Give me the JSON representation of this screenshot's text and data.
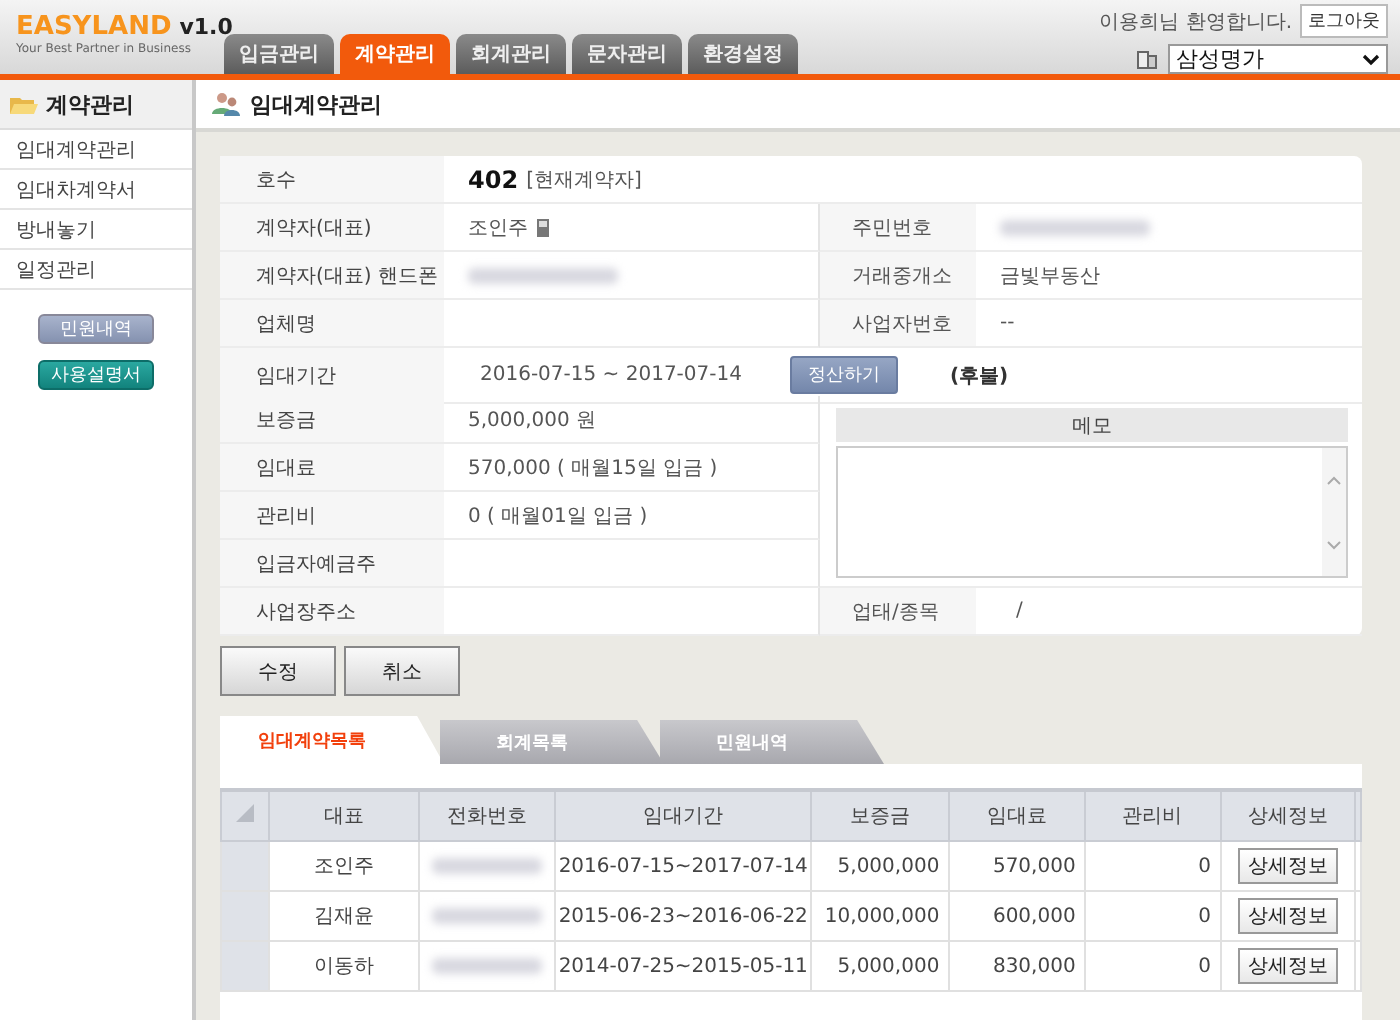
{
  "header": {
    "logo": "EASYLAND",
    "version": "v1.0",
    "tagline": "Your Best Partner in Business",
    "welcome": "이용희님 환영합니다.",
    "logout": "로그아웃",
    "building_select": "삼성명가",
    "tabs": [
      {
        "label": "입금관리",
        "selected": false
      },
      {
        "label": "계약관리",
        "selected": true
      },
      {
        "label": "회계관리",
        "selected": false
      },
      {
        "label": "문자관리",
        "selected": false
      },
      {
        "label": "환경설정",
        "selected": false
      }
    ]
  },
  "sidebar": {
    "title": "계약관리",
    "items": [
      "임대계약관리",
      "임대차계약서",
      "방내놓기",
      "일정관리"
    ],
    "buttons": [
      {
        "label": "민원내역",
        "kind": "grey"
      },
      {
        "label": "사용설명서",
        "kind": "teal"
      }
    ]
  },
  "page_title": "임대계약관리",
  "form": {
    "unit": {
      "label": "호수",
      "value": "402",
      "status": "[현재계약자]"
    },
    "pairs": [
      {
        "label": "계약자(대표)",
        "value": "조인주",
        "phone_icon": true,
        "label2": "주민번호",
        "blurred2": true
      },
      {
        "label": "계약자(대표) 핸드폰",
        "blurred": true,
        "label2": "거래중개소",
        "value2": "금빛부동산"
      },
      {
        "label": "업체명",
        "label2": "사업자번호",
        "value2": "--"
      }
    ],
    "period": {
      "label": "임대기간",
      "value": "2016-07-15 ~ 2017-07-14",
      "button": "정산하기",
      "note": "(후불)"
    },
    "money": [
      {
        "label": "보증금",
        "value": "5,000,000 원"
      },
      {
        "label": "임대료",
        "value": "570,000 ( 매월15일 입금 )"
      },
      {
        "label": "관리비",
        "value": "0 ( 매월01일 입금 )"
      },
      {
        "label": "입금자예금주"
      }
    ],
    "memo": {
      "title": "메모"
    },
    "address": {
      "label": "사업장주소",
      "label2": "업태/종목",
      "value2": "/"
    }
  },
  "actions": [
    "수정",
    "취소"
  ],
  "list_tabs": [
    {
      "label": "임대계약목록",
      "selected": true
    },
    {
      "label": "회계목록",
      "selected": false
    },
    {
      "label": "민원내역",
      "selected": false
    }
  ],
  "table": {
    "columns": [
      "대표",
      "전화번호",
      "임대기간",
      "보증금",
      "임대료",
      "관리비",
      "상세정보"
    ],
    "rows": [
      {
        "name": "조인주",
        "period": "2016-07-15~2017-07-14",
        "deposit": "5,000,000",
        "rent": "570,000",
        "fee": "0",
        "detail": "상세정보"
      },
      {
        "name": "김재윤",
        "period": "2015-06-23~2016-06-22",
        "deposit": "10,000,000",
        "rent": "600,000",
        "fee": "0",
        "detail": "상세정보"
      },
      {
        "name": "이동하",
        "period": "2014-07-25~2015-05-11",
        "deposit": "5,000,000",
        "rent": "830,000",
        "fee": "0",
        "detail": "상세정보"
      }
    ]
  }
}
